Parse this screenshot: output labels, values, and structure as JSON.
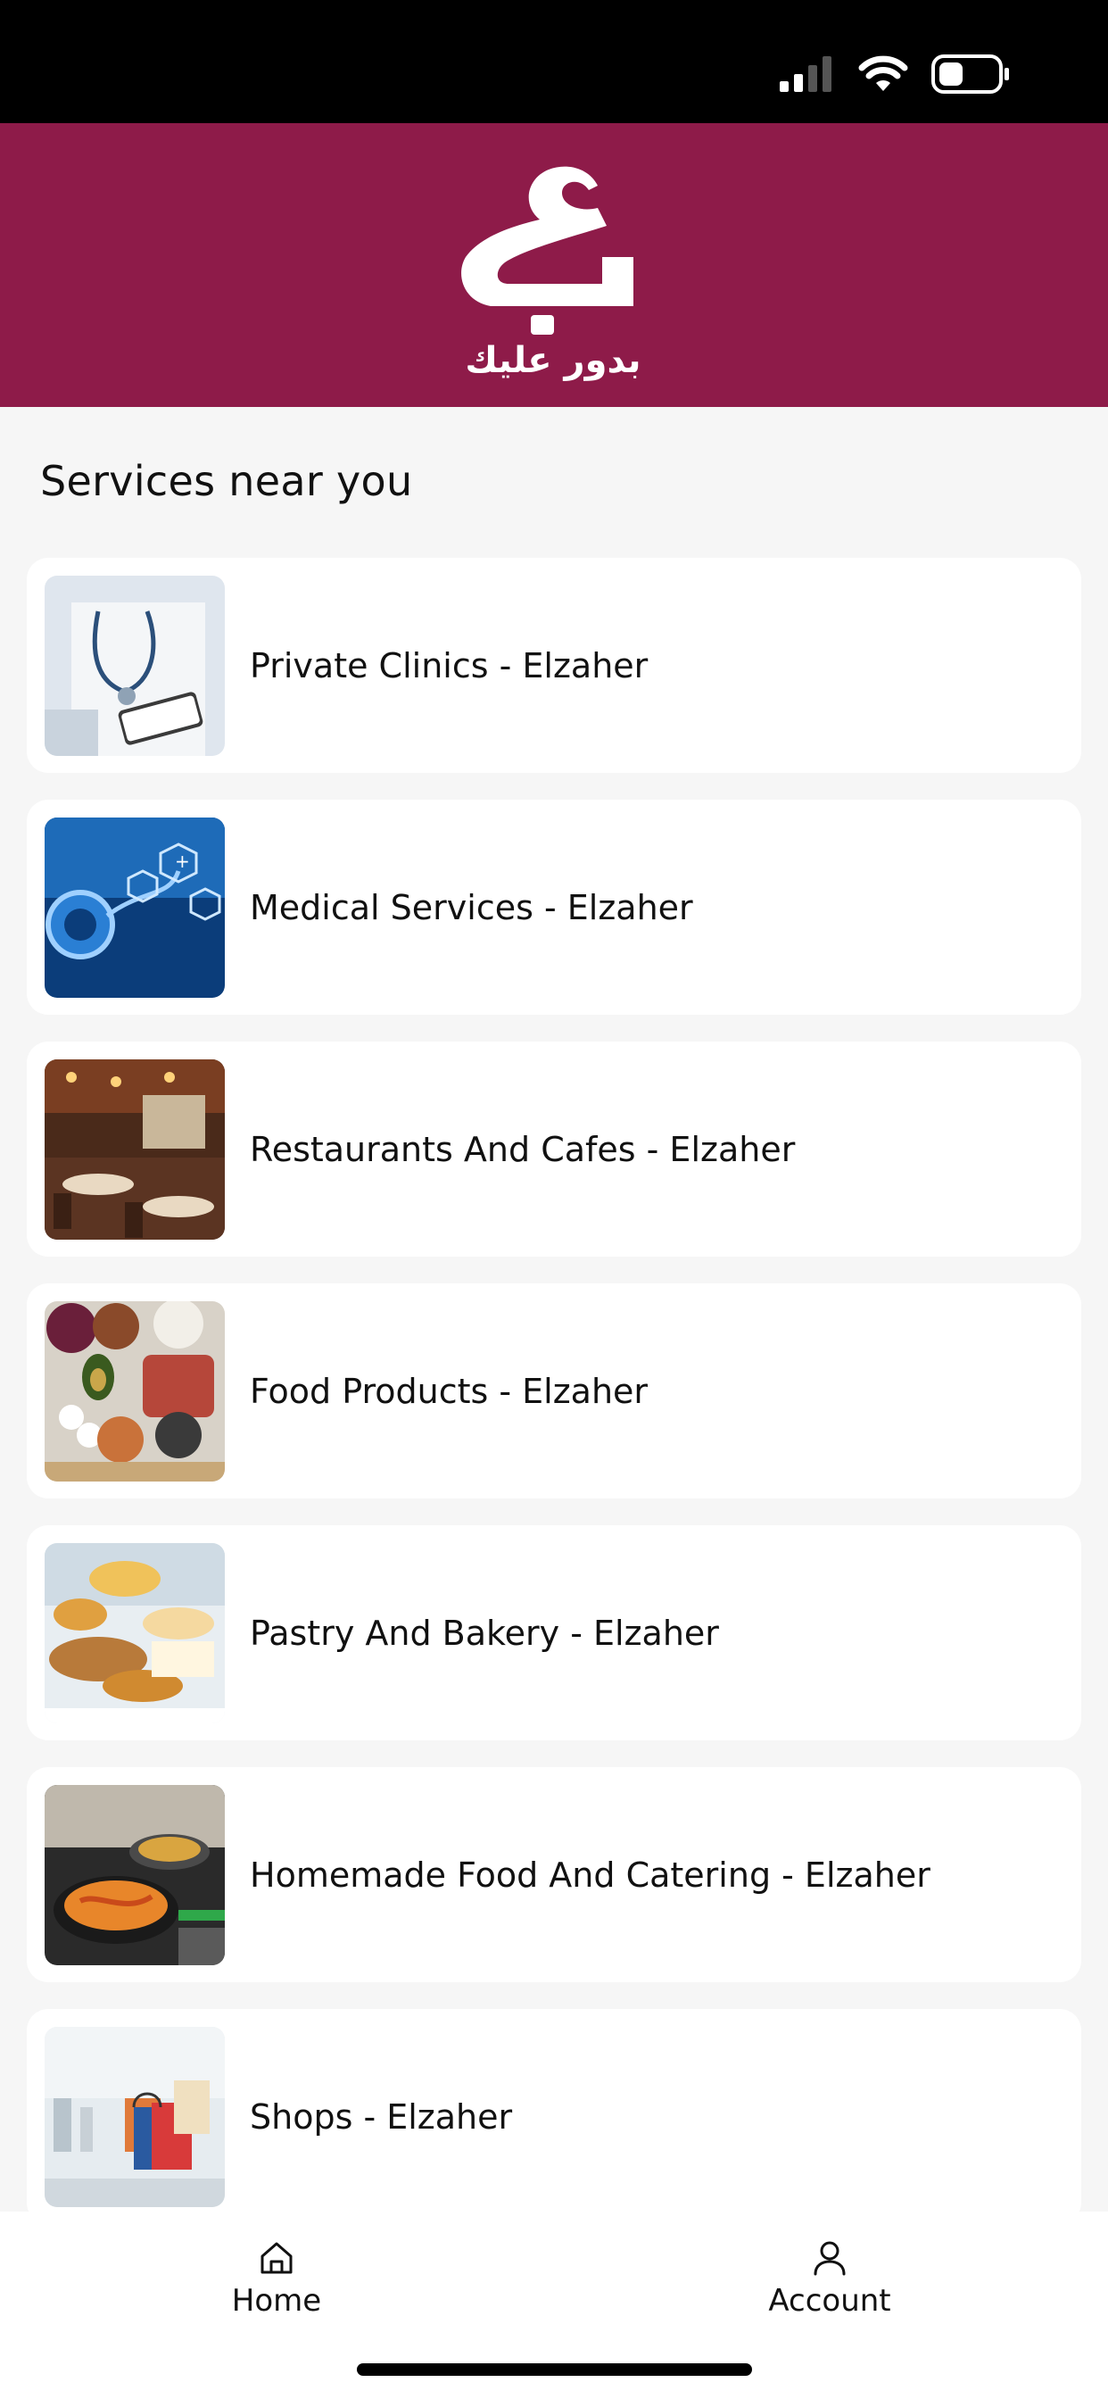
{
  "status_bar": {
    "icons": [
      "cellular-signal-icon",
      "wifi-icon",
      "battery-icon"
    ]
  },
  "header": {
    "logo_name": "app-logo",
    "logo_text": "بدور عليك",
    "background_color": "#8e1b49"
  },
  "main": {
    "section_title": "Services near you",
    "services": [
      {
        "label": "Private Clinics - Elzaher",
        "image": "doctor-with-stethoscope"
      },
      {
        "label": "Medical Services - Elzaher",
        "image": "stethoscope-medical-icons"
      },
      {
        "label": "Restaurants And Cafes - Elzaher",
        "image": "restaurant-interior"
      },
      {
        "label": "Food Products - Elzaher",
        "image": "assorted-food-products"
      },
      {
        "label": "Pastry And Bakery - Elzaher",
        "image": "croissants-and-pastries"
      },
      {
        "label": "Homemade Food And Catering - Elzaher",
        "image": "cooking-pan"
      },
      {
        "label": "Shops - Elzaher",
        "image": "shopping-bags-mall"
      }
    ]
  },
  "bottom_nav": {
    "items": [
      {
        "label": "Home",
        "icon": "home-icon"
      },
      {
        "label": "Account",
        "icon": "user-icon"
      }
    ]
  }
}
